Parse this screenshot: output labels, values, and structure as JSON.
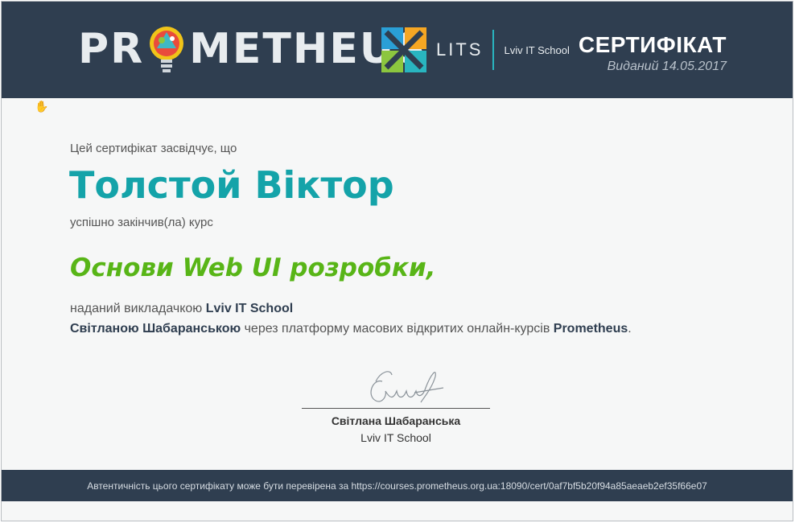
{
  "header": {
    "brand_left": "PR",
    "brand_right": "METHEUS",
    "partner_name": "LITS",
    "partner_school": "Lviv IT School",
    "title": "СЕРТИФІКАТ",
    "issued": "Виданий 14.05.2017"
  },
  "body": {
    "certifies_text": "Цей сертифікат засвідчує, що",
    "recipient_name": "Толстой Віктор",
    "completed_text": "успішно закінчив(ла) курс",
    "course_title": "Основи Web UI розробки,",
    "given_prefix": "наданий викладачкою ",
    "institution": "Lviv IT School",
    "instructor": "Світланою Шабаранською",
    "via_text": " через платформу масових відкритих онлайн-курсів ",
    "platform": "Prometheus",
    "period": "."
  },
  "signature": {
    "name": "Світлана Шабаранська",
    "org": "Lviv IT School"
  },
  "footer": {
    "verify_text": "Автентичність цього сертифікату може бути перевірена за https://courses.prometheus.org.ua:18090/cert/0af7bf5b20f94a85aeaeb2ef35f66e07"
  },
  "colors": {
    "header_bg": "#2f3e50",
    "name_teal": "#14a3a9",
    "course_green": "#58b517",
    "lits_green": "#8cc63f",
    "lits_orange": "#f5a623",
    "lits_blue": "#2a9fd6"
  },
  "icons": [
    "lightbulb-logo-icon",
    "lits-logo-icon",
    "hand-cursor-icon"
  ]
}
